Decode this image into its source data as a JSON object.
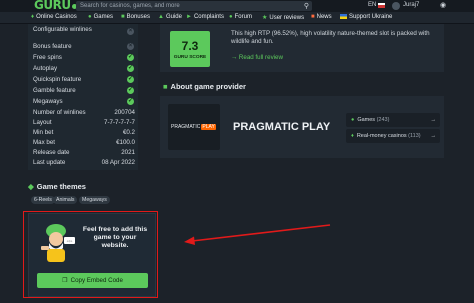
{
  "topbar": {
    "logo": "GURU",
    "search_placeholder": "Search for casinos, games, and more",
    "lang": "EN",
    "username": "Juraj7"
  },
  "nav": {
    "items": [
      {
        "label": "Online Casinos",
        "icon": "casino-icon"
      },
      {
        "label": "Games",
        "icon": "gamepad-icon"
      },
      {
        "label": "Bonuses",
        "icon": "gift-icon"
      },
      {
        "label": "Guide",
        "icon": "guide-icon"
      },
      {
        "label": "Complaints",
        "icon": "megaphone-icon"
      },
      {
        "label": "Forum",
        "icon": "forum-icon"
      },
      {
        "label": "User reviews",
        "icon": "star-icon"
      },
      {
        "label": "News",
        "icon": "news-icon"
      },
      {
        "label": "Support Ukraine",
        "icon": "ukraine-flag-icon"
      }
    ]
  },
  "features": {
    "configurable_winlines": "Configurable winlines",
    "bonus_feature": "Bonus feature",
    "free_spins": "Free spins",
    "autoplay": "Autoplay",
    "quickspin": "Quickspin feature",
    "gamble": "Gamble feature",
    "megaways": "Megaways"
  },
  "details": [
    {
      "label": "Number of winlines",
      "value": "200704"
    },
    {
      "label": "Layout",
      "value": "7-7-7-7-7-7"
    },
    {
      "label": "Min bet",
      "value": "€0.2"
    },
    {
      "label": "Max bet",
      "value": "€100.0"
    },
    {
      "label": "Release date",
      "value": "2021"
    },
    {
      "label": "Last update",
      "value": "08 Apr 2022"
    }
  ],
  "themes": {
    "title": "Game themes",
    "tags": [
      "6-Reels",
      "Animals",
      "Megaways"
    ]
  },
  "embed": {
    "text": "Feel free to add this game to your website.",
    "button": "Copy Embed Code"
  },
  "score": {
    "value": "7.3",
    "label": "GURU SCORE",
    "description": "This high RTP (96.52%), high volatility nature-themed slot is packed with wildlife and fun.",
    "read_full": "Read full review"
  },
  "provider": {
    "section_title": "About game provider",
    "logo_text": "PRAGMATIC",
    "logo_badge": "PLAY",
    "name": "PRAGMATIC PLAY",
    "games_label": "Games",
    "games_count": "(243)",
    "casinos_label": "Real-money casinos",
    "casinos_count": "(113)"
  },
  "colors": {
    "accent_green": "#5cc95c",
    "annotation_red": "#e11a1a",
    "background": "#1c2229"
  }
}
